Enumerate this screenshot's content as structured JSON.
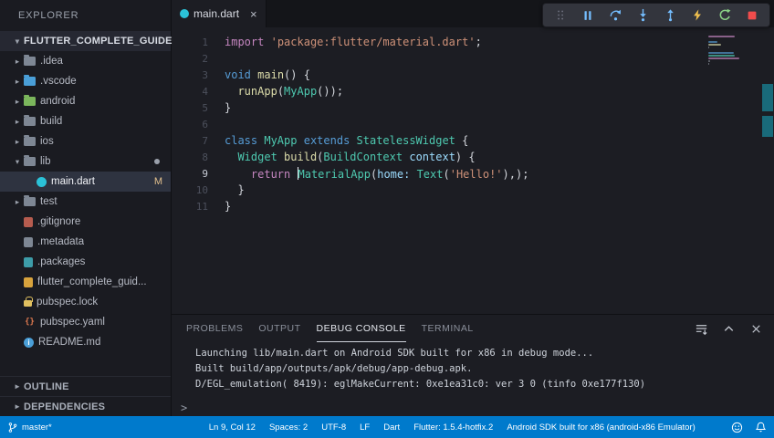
{
  "colors": {
    "statusbar": "#007acc",
    "editor-bg": "#1c1d23",
    "sidebar-bg": "#1a1b21",
    "tabbar-bg": "#141519",
    "selection-row": "#2e3340",
    "modified-badge": "#e2c08d",
    "accent-blue": "#75beff",
    "accent-yellow": "#f2c14e",
    "accent-green": "#89d185",
    "accent-red": "#f14c4c"
  },
  "glyphs": {
    "close": "×",
    "chevron_collapsed": "▸",
    "chevron_expanded": "▾",
    "prompt": ">"
  },
  "explorer": {
    "title": "EXPLORER",
    "project": "FLUTTER_COMPLETE_GUIDE",
    "items": [
      {
        "label": ".idea",
        "indent": 12,
        "chevron": "collapsed",
        "icon": {
          "kind": "folder",
          "color": "#7e8794",
          "name": "folder"
        }
      },
      {
        "label": ".vscode",
        "indent": 12,
        "chevron": "collapsed",
        "icon": {
          "kind": "folder",
          "color": "#4a9fd8",
          "name": "vscode-folder"
        }
      },
      {
        "label": "android",
        "indent": 12,
        "chevron": "collapsed",
        "icon": {
          "kind": "folder",
          "color": "#7bb65c",
          "name": "android-folder"
        }
      },
      {
        "label": "build",
        "indent": 12,
        "chevron": "collapsed",
        "icon": {
          "kind": "folder",
          "color": "#7e8794",
          "name": "folder"
        }
      },
      {
        "label": "ios",
        "indent": 12,
        "chevron": "collapsed",
        "icon": {
          "kind": "folder",
          "color": "#7e8794",
          "name": "folder"
        }
      },
      {
        "label": "lib",
        "indent": 12,
        "chevron": "expanded",
        "icon": {
          "kind": "folder",
          "color": "#7e8794",
          "name": "folder"
        },
        "dot": true
      },
      {
        "label": "main.dart",
        "indent": 40,
        "icon": {
          "kind": "circle",
          "color": "#2bc2d8",
          "name": "dart-file"
        },
        "badge": "M",
        "selected": true
      },
      {
        "label": "test",
        "indent": 12,
        "chevron": "collapsed",
        "icon": {
          "kind": "folder",
          "color": "#7e8794",
          "name": "folder"
        }
      },
      {
        "label": ".gitignore",
        "indent": 26,
        "icon": {
          "kind": "square",
          "color": "#b65c4f",
          "name": "git-file"
        }
      },
      {
        "label": ".metadata",
        "indent": 26,
        "icon": {
          "kind": "square",
          "color": "#7e8794",
          "name": "metadata-file"
        }
      },
      {
        "label": ".packages",
        "indent": 26,
        "icon": {
          "kind": "square",
          "color": "#3d9ca8",
          "name": "packages-file"
        }
      },
      {
        "label": "flutter_complete_guid...",
        "indent": 26,
        "icon": {
          "kind": "square",
          "color": "#d8a33d",
          "name": "iml-file"
        }
      },
      {
        "label": "pubspec.lock",
        "indent": 26,
        "icon": {
          "kind": "lock",
          "color": "#e0c060",
          "name": "lock-file"
        }
      },
      {
        "label": "pubspec.yaml",
        "indent": 26,
        "icon": {
          "kind": "glyph",
          "color": "#e07a50",
          "glyph": "{}",
          "name": "yaml-file"
        }
      },
      {
        "label": "README.md",
        "indent": 26,
        "icon": {
          "kind": "info",
          "color": "#4a9fd8",
          "name": "readme-file"
        }
      }
    ],
    "sections": [
      {
        "label": "OUTLINE"
      },
      {
        "label": "DEPENDENCIES"
      }
    ]
  },
  "editor": {
    "tab": {
      "label": "main.dart"
    },
    "cursor": {
      "line": 9,
      "col": 12
    },
    "lines": [
      {
        "n": "1",
        "tokens": [
          {
            "c": "kw2",
            "t": "import"
          },
          {
            "c": "pl",
            "t": " "
          },
          {
            "c": "str",
            "t": "'package:flutter/material.dart'"
          },
          {
            "c": "pl",
            "t": ";"
          }
        ]
      },
      {
        "n": "2",
        "tokens": []
      },
      {
        "n": "3",
        "tokens": [
          {
            "c": "kw",
            "t": "void"
          },
          {
            "c": "pl",
            "t": " "
          },
          {
            "c": "fn",
            "t": "main"
          },
          {
            "c": "pl",
            "t": "() {"
          }
        ]
      },
      {
        "n": "4",
        "tokens": [
          {
            "c": "pl",
            "t": "  "
          },
          {
            "c": "fn",
            "t": "runApp"
          },
          {
            "c": "pl",
            "t": "("
          },
          {
            "c": "type",
            "t": "MyApp"
          },
          {
            "c": "pl",
            "t": "());"
          }
        ]
      },
      {
        "n": "5",
        "tokens": [
          {
            "c": "pl",
            "t": "}"
          }
        ]
      },
      {
        "n": "6",
        "tokens": []
      },
      {
        "n": "7",
        "tokens": [
          {
            "c": "kw",
            "t": "class"
          },
          {
            "c": "pl",
            "t": " "
          },
          {
            "c": "type",
            "t": "MyApp"
          },
          {
            "c": "pl",
            "t": " "
          },
          {
            "c": "kw",
            "t": "extends"
          },
          {
            "c": "pl",
            "t": " "
          },
          {
            "c": "type",
            "t": "StatelessWidget"
          },
          {
            "c": "pl",
            "t": " {"
          }
        ]
      },
      {
        "n": "8",
        "tokens": [
          {
            "c": "pl",
            "t": "  "
          },
          {
            "c": "type",
            "t": "Widget"
          },
          {
            "c": "pl",
            "t": " "
          },
          {
            "c": "fn",
            "t": "build"
          },
          {
            "c": "pl",
            "t": "("
          },
          {
            "c": "type",
            "t": "BuildContext"
          },
          {
            "c": "pl",
            "t": " "
          },
          {
            "c": "var",
            "t": "context"
          },
          {
            "c": "pl",
            "t": ") {"
          }
        ]
      },
      {
        "n": "9",
        "active": true,
        "tokens": [
          {
            "c": "pl",
            "t": "    "
          },
          {
            "c": "kw2",
            "t": "return"
          },
          {
            "c": "pl",
            "t": " "
          },
          {
            "c": "cursor",
            "t": ""
          },
          {
            "c": "type",
            "t": "MaterialApp"
          },
          {
            "c": "pl",
            "t": "("
          },
          {
            "c": "var",
            "t": "home:"
          },
          {
            "c": "pl",
            "t": " "
          },
          {
            "c": "type",
            "t": "Text"
          },
          {
            "c": "pl",
            "t": "("
          },
          {
            "c": "str",
            "t": "'Hello!'"
          },
          {
            "c": "pl",
            "t": "),);"
          }
        ]
      },
      {
        "n": "10",
        "tokens": [
          {
            "c": "pl",
            "t": "  }"
          }
        ]
      },
      {
        "n": "11",
        "tokens": [
          {
            "c": "pl",
            "t": "}"
          }
        ]
      }
    ]
  },
  "debug_toolbar": {
    "icons": [
      "gripper",
      "pause",
      "step-over",
      "step-into",
      "step-out",
      "hot-reload",
      "restart",
      "stop"
    ]
  },
  "panel": {
    "tabs": [
      {
        "label": "PROBLEMS"
      },
      {
        "label": "OUTPUT"
      },
      {
        "label": "DEBUG CONSOLE",
        "active": true
      },
      {
        "label": "TERMINAL"
      }
    ],
    "console_lines": [
      "Launching lib/main.dart on Android SDK built for x86 in debug mode...",
      "Built build/app/outputs/apk/debug/app-debug.apk.",
      "D/EGL_emulation( 8419): eglMakeCurrent: 0xe1ea31c0: ver 3 0 (tinfo 0xe177f130)"
    ]
  },
  "statusbar": {
    "branch_label": "master*",
    "items": [
      "Ln 9, Col 12",
      "Spaces: 2",
      "UTF-8",
      "LF",
      "Dart",
      "Flutter: 1.5.4-hotfix.2",
      "Android SDK built for x86 (android-x86 Emulator)"
    ]
  }
}
